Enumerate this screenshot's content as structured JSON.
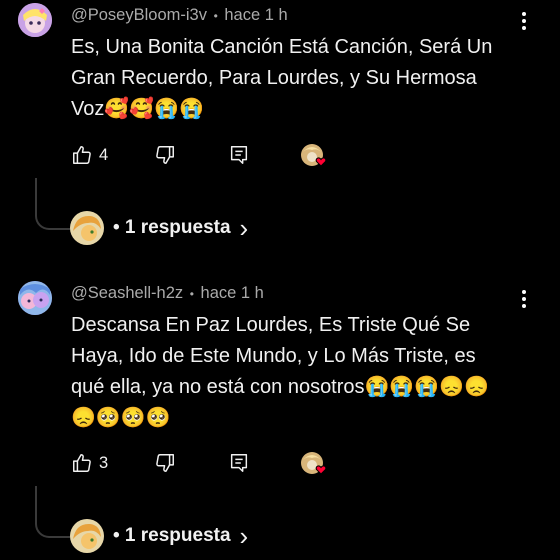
{
  "comments": [
    {
      "handle": "@PoseyBloom-i3v",
      "separator": "•",
      "time": "hace 1 h",
      "line1": "Es, Una Bonita Canción Está Canción, Será Un",
      "line2": "Gran Recuerdo, Para Lourdes, y Su Hermosa",
      "line3": "Voz🥰🥰😭😭",
      "likes": "4",
      "replies_label": "• 1 respuesta",
      "reply_chevron": "›"
    },
    {
      "handle": "@Seashell-h2z",
      "separator": "•",
      "time": "hace 1 h",
      "line1": "Descansa En Paz Lourdes, Es Triste Qué Se",
      "line2": "Haya, Ido de Este Mundo, y Lo Más Triste, es",
      "line3": "qué ella, ya no está con nosotros😭😭😭😞😞",
      "line4": "😞🥺🥺🥺",
      "likes": "3",
      "replies_label": "• 1 respuesta",
      "reply_chevron": "›"
    }
  ],
  "icons": {
    "like": "thumbs-up-icon",
    "dislike": "thumbs-down-icon",
    "reply": "comment-icon",
    "creator_heart": "creator-heart-icon",
    "more": "more-vertical-icon"
  },
  "colors": {
    "background": "#000000",
    "text": "#f1f1f1",
    "meta": "#aaaaaa",
    "heart": "#ff0033"
  }
}
